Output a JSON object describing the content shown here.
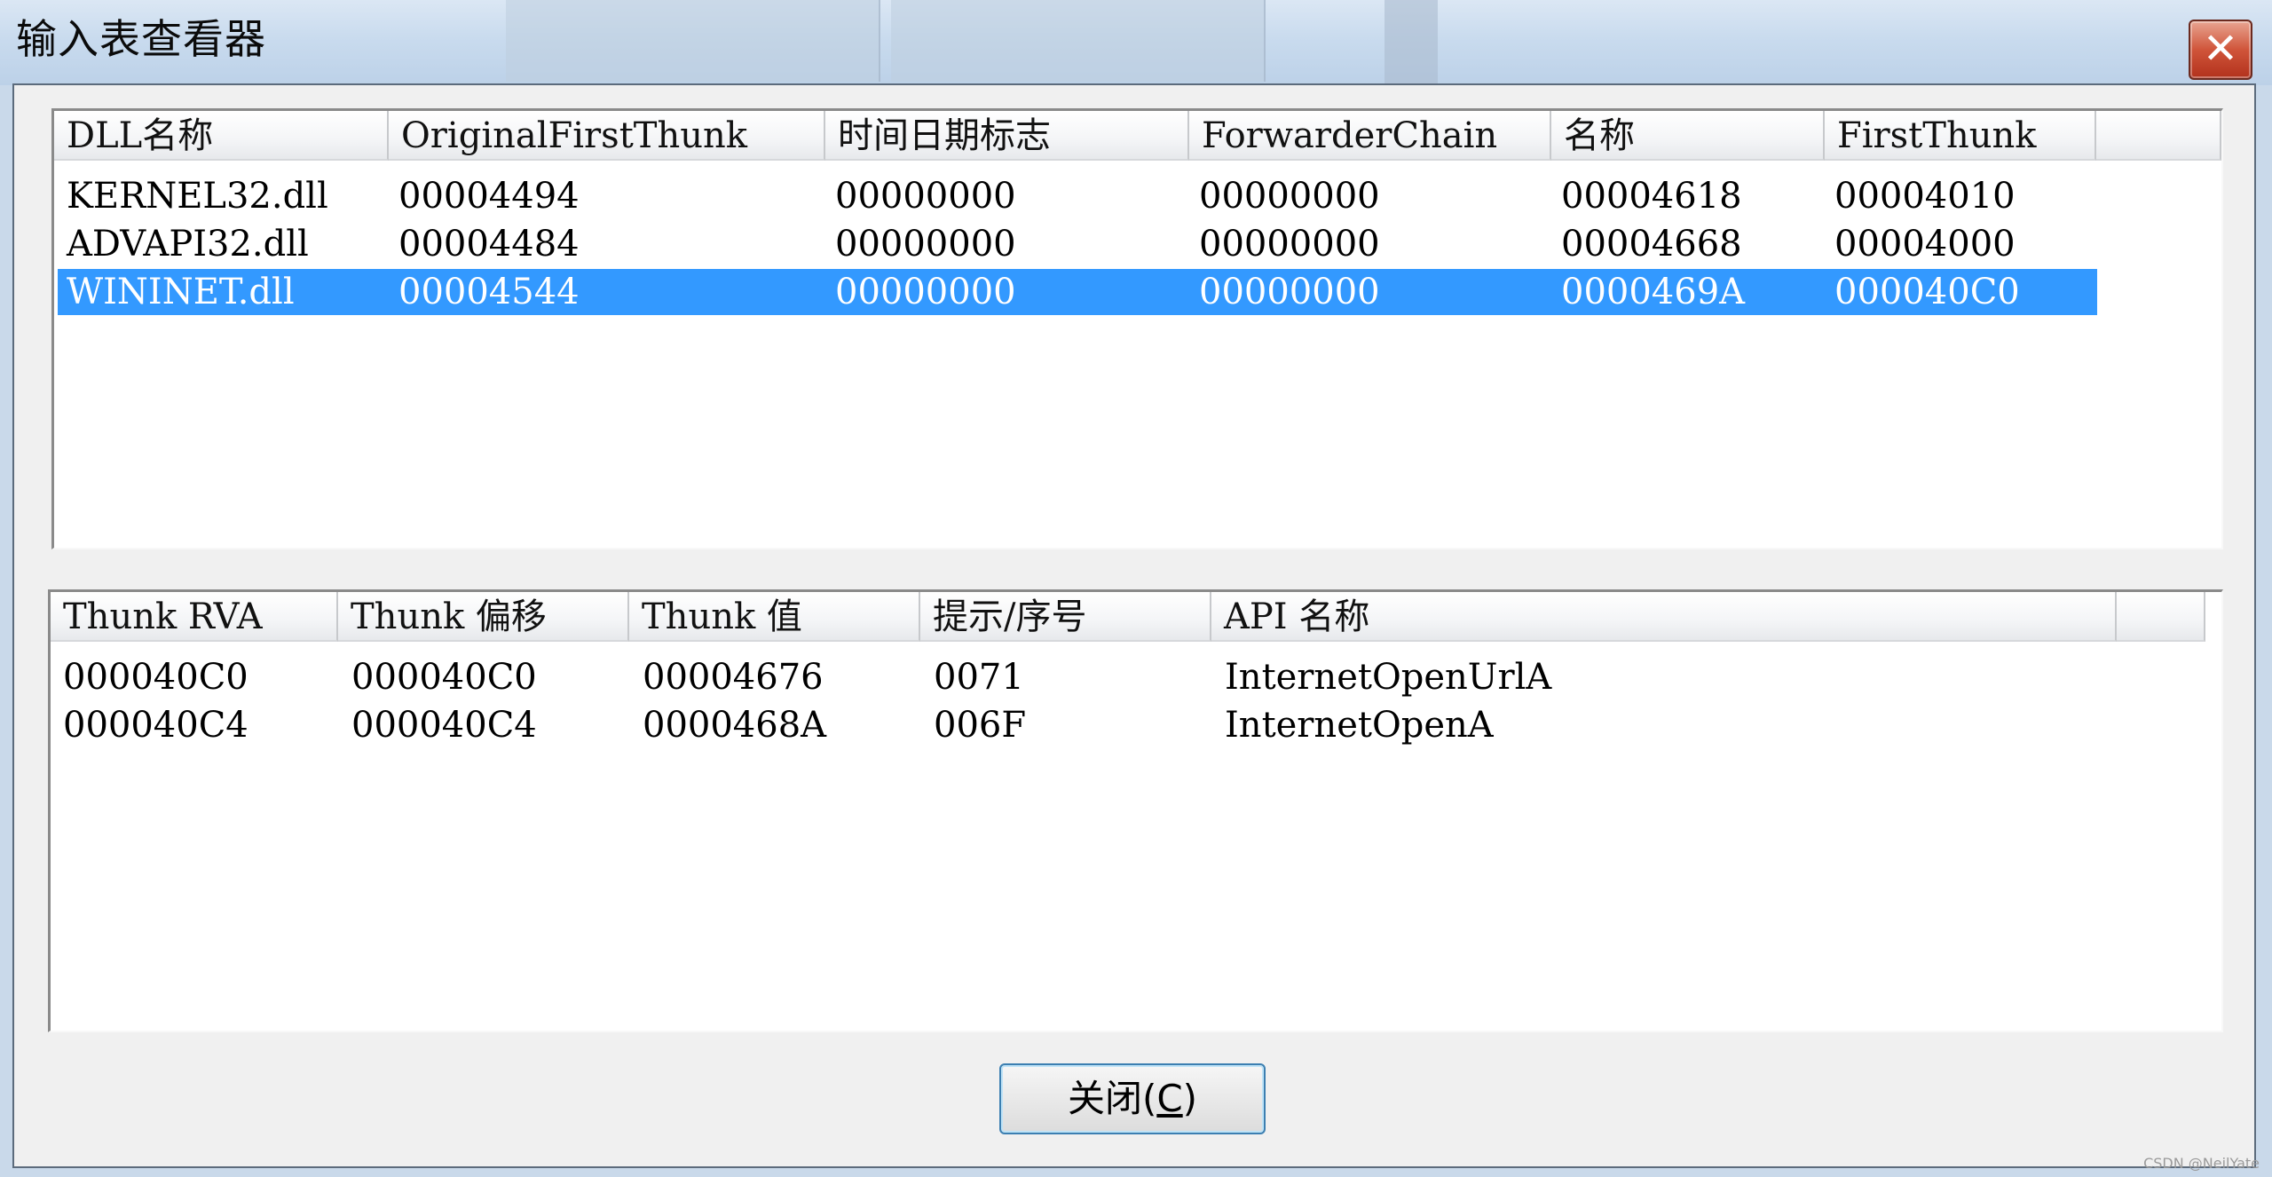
{
  "window": {
    "title": "输入表查看器",
    "close_glyph": "✕"
  },
  "background": {
    "ghost_tabs": [
      "",
      ""
    ]
  },
  "dll_table": {
    "columns": [
      "DLL名称",
      "OriginalFirstThunk",
      "时间日期标志",
      "ForwarderChain",
      "名称",
      "FirstThunk",
      ""
    ],
    "rows": [
      [
        "KERNEL32.dll",
        "00004494",
        "00000000",
        "00000000",
        "00004618",
        "00004010"
      ],
      [
        "ADVAPI32.dll",
        "00004484",
        "00000000",
        "00000000",
        "00004668",
        "00004000"
      ],
      [
        "WININET.dll",
        "00004544",
        "00000000",
        "00000000",
        "0000469A",
        "000040C0"
      ]
    ],
    "selected_row": 2
  },
  "thunk_table": {
    "columns": [
      "Thunk RVA",
      "Thunk 偏移",
      "Thunk 值",
      "提示/序号",
      "API 名称",
      ""
    ],
    "rows": [
      [
        "000040C0",
        "000040C0",
        "00004676",
        "0071",
        "InternetOpenUrlA"
      ],
      [
        "000040C4",
        "000040C4",
        "0000468A",
        "006F",
        "InternetOpenA"
      ]
    ]
  },
  "close_button": {
    "label_prefix": "关闭(",
    "label_hotkey": "C",
    "label_suffix": ")"
  },
  "watermark": "CSDN @NeilYate"
}
